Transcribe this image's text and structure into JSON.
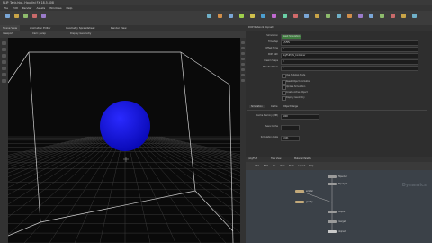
{
  "window": {
    "title": "FLIP_Tank.hip - Houdini FX 18.5.408"
  },
  "menu": [
    "File",
    "Edit",
    "Render",
    "Assets",
    "Windows",
    "Help"
  ],
  "main": {
    "tabs": [
      "Scene View",
      "Animation Editor",
      "Geometry Spreadsheet",
      "Render View"
    ]
  },
  "viewport": {
    "overlay_tabs": [
      "Viewport",
      "Cam: persp",
      "Display Geometry"
    ],
    "sphere_color": "#1010d8",
    "grid_color": "#3a3a3a",
    "frame_color": "#d0d0d0"
  },
  "parameters": {
    "header": "DOP Network  dopnet1",
    "rows": [
      {
        "label": "Simulation",
        "value": "Reset Simulation"
      },
      {
        "label": "Timestep",
        "value": "1/$FPS"
      },
      {
        "label": "Offset Time",
        "value": "0"
      },
      {
        "label": "DOP Path",
        "value": "obj/FLIP/ML_Container"
      },
      {
        "label": "Presim Steps",
        "value": "0"
      },
      {
        "label": "Max Feedback",
        "value": "1"
      }
    ],
    "checks": [
      "Use Substep Mode",
      "Reset Object Animation",
      "Update Simulation",
      "Create Active Object",
      "Display Geometry"
    ],
    "subtabs": [
      "Simulation",
      "Cache",
      "Object Merge"
    ],
    "cache_rows": [
      {
        "label": "Cache Memory (MB)",
        "value": "5000"
      },
      {
        "label": "Save Cache",
        "value": ""
      },
      {
        "label": "Simulation Data",
        "value": "0.041"
      }
    ]
  },
  "network": {
    "path_tabs": [
      "/obj/FLIP",
      "Tree View",
      "Material Palette"
    ],
    "menu": [
      "Add",
      "Edit",
      "Go",
      "View",
      "Tools",
      "Layout",
      "Help"
    ],
    "watermark": "Dynamics",
    "nodes": [
      "emitter",
      "flipsolver",
      "flipobject",
      "gravity",
      "output",
      "merge1",
      "dopnet"
    ]
  }
}
